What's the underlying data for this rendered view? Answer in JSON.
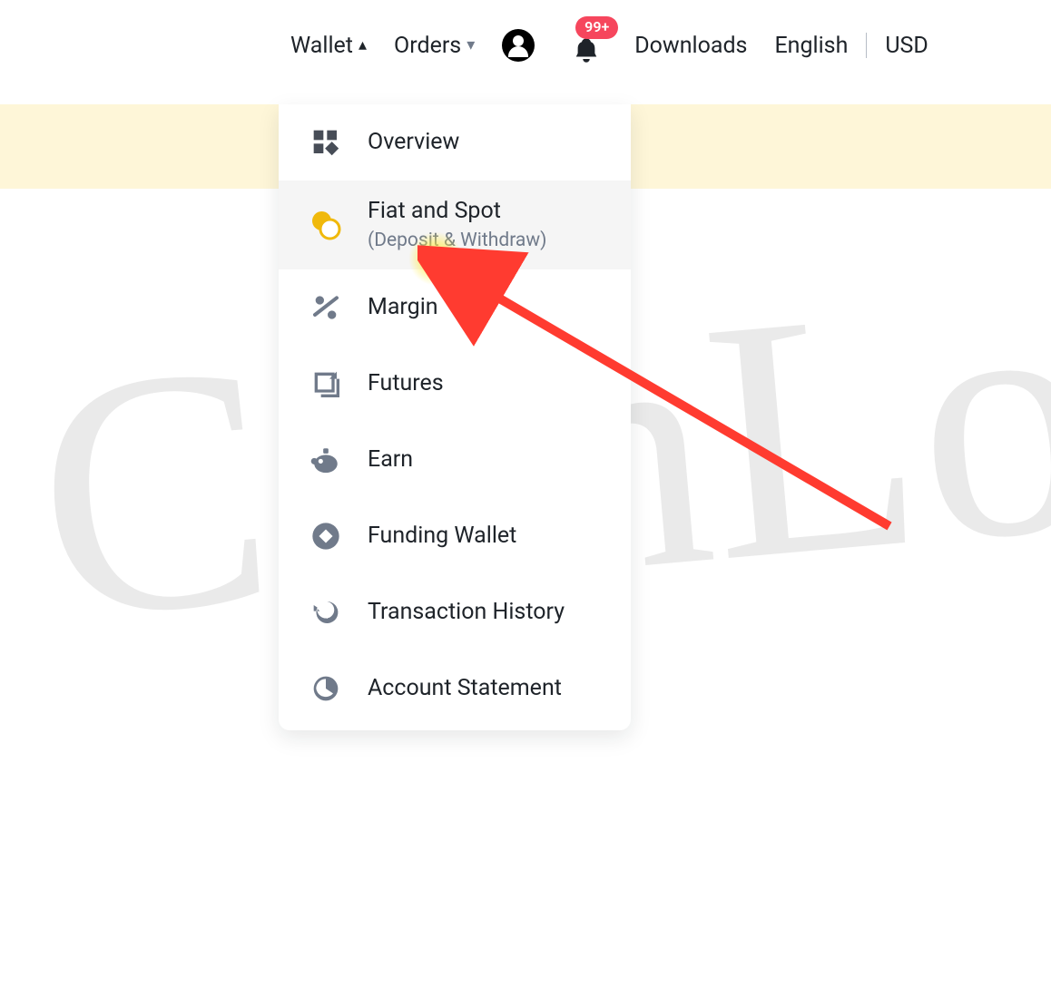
{
  "nav": {
    "wallet": "Wallet",
    "orders": "Orders",
    "downloads": "Downloads",
    "language": "English",
    "currency": "USD",
    "notification_badge": "99+"
  },
  "wallet_menu": {
    "items": [
      {
        "label": "Overview",
        "sublabel": null,
        "icon": "overview-icon"
      },
      {
        "label": "Fiat and Spot",
        "sublabel": "(Deposit & Withdraw)",
        "icon": "fiat-spot-icon"
      },
      {
        "label": "Margin",
        "sublabel": null,
        "icon": "margin-icon"
      },
      {
        "label": "Futures",
        "sublabel": null,
        "icon": "futures-icon"
      },
      {
        "label": "Earn",
        "sublabel": null,
        "icon": "earn-icon"
      },
      {
        "label": "Funding Wallet",
        "sublabel": null,
        "icon": "funding-wallet-icon"
      },
      {
        "label": "Transaction History",
        "sublabel": null,
        "icon": "transaction-history-icon"
      },
      {
        "label": "Account Statement",
        "sublabel": null,
        "icon": "account-statement-icon"
      }
    ]
  }
}
